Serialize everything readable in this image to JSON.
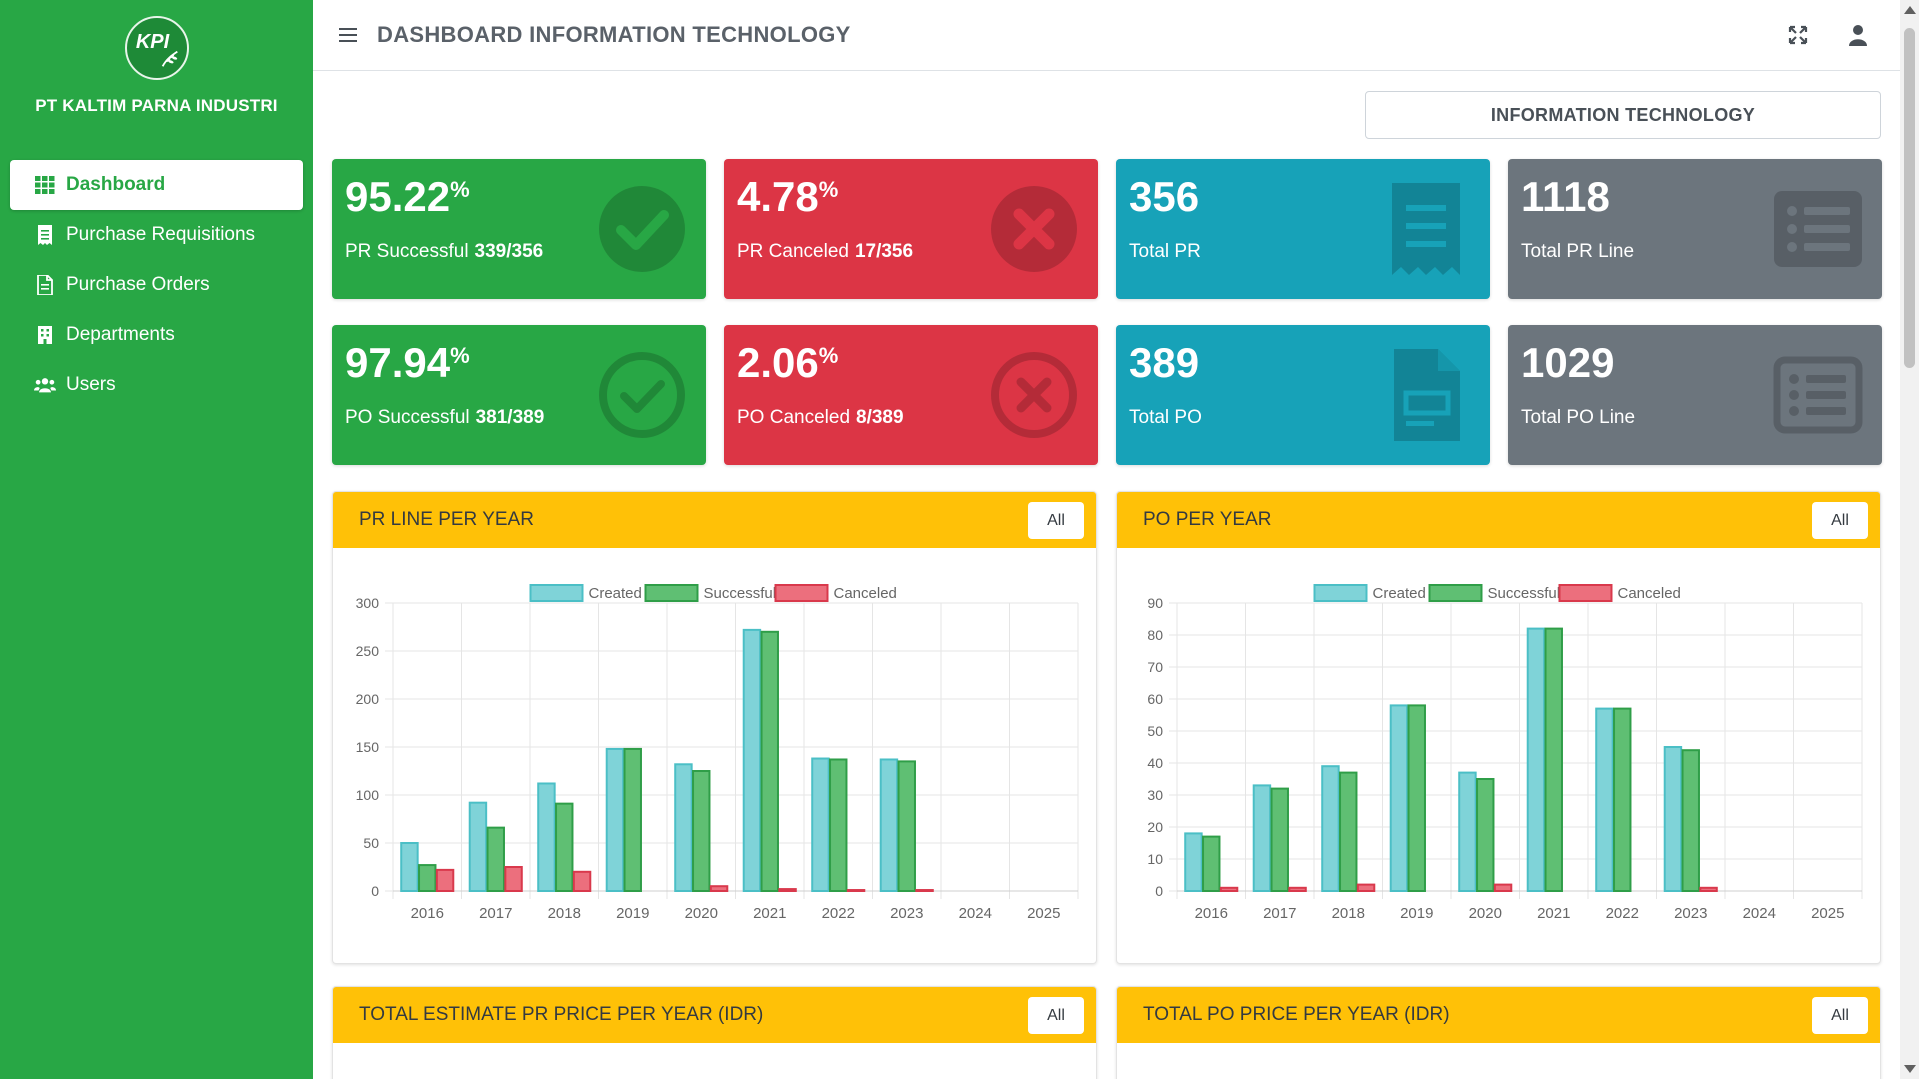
{
  "sidebar": {
    "logo_text": "KPI",
    "brand_name": "PT KALTIM PARNA INDUSTRI",
    "items": [
      {
        "label": "Dashboard",
        "icon": "grid-icon",
        "active": true
      },
      {
        "label": "Purchase Requisitions",
        "icon": "receipt-icon",
        "active": false
      },
      {
        "label": "Purchase Orders",
        "icon": "document-icon",
        "active": false
      },
      {
        "label": "Departments",
        "icon": "building-icon",
        "active": false
      },
      {
        "label": "Users",
        "icon": "users-icon",
        "active": false
      }
    ]
  },
  "header": {
    "title": "DASHBOARD INFORMATION TECHNOLOGY",
    "icons": [
      "menu-icon",
      "expand-icon",
      "user-icon"
    ]
  },
  "department_button": "INFORMATION TECHNOLOGY",
  "stats": {
    "pr_successful": {
      "value": "95.22",
      "unit": "%",
      "label": "PR Successful",
      "detail": "339/356"
    },
    "pr_canceled": {
      "value": "4.78",
      "unit": "%",
      "label": "PR Canceled",
      "detail": "17/356"
    },
    "total_pr": {
      "value": "356",
      "label": "Total PR"
    },
    "total_pr_line": {
      "value": "1118",
      "label": "Total PR Line"
    },
    "po_successful": {
      "value": "97.94",
      "unit": "%",
      "label": "PO Successful",
      "detail": "381/389"
    },
    "po_canceled": {
      "value": "2.06",
      "unit": "%",
      "label": "PO Canceled",
      "detail": "8/389"
    },
    "total_po": {
      "value": "389",
      "label": "Total PO"
    },
    "total_po_line": {
      "value": "1029",
      "label": "Total PO Line"
    }
  },
  "colors": {
    "green": "#28a745",
    "red": "#dc3545",
    "cyan": "#17a2b8",
    "gray": "#6c757d",
    "yellow": "#ffc107",
    "created_fill": "#7fd3d8",
    "created_stroke": "#4bbfc6",
    "successful_fill": "#5fbf73",
    "successful_stroke": "#2f9e48",
    "canceled_fill": "#ec6f7d",
    "canceled_stroke": "#d9394c"
  },
  "cards": {
    "pr_line": {
      "title": "PR LINE PER YEAR",
      "button": "All"
    },
    "po": {
      "title": "PO PER YEAR",
      "button": "All"
    },
    "pr_price": {
      "title": "TOTAL ESTIMATE PR PRICE PER YEAR (IDR)",
      "button": "All"
    },
    "po_price": {
      "title": "TOTAL PO PRICE PER YEAR (IDR)",
      "button": "All"
    }
  },
  "chart_data": [
    {
      "type": "bar",
      "title": "PR LINE PER YEAR",
      "categories": [
        "2016",
        "2017",
        "2018",
        "2019",
        "2020",
        "2021",
        "2022",
        "2023",
        "2024",
        "2025"
      ],
      "series": [
        {
          "name": "Created",
          "values": [
            50,
            92,
            112,
            148,
            132,
            272,
            138,
            137,
            0,
            0
          ]
        },
        {
          "name": "Successful",
          "values": [
            27,
            66,
            91,
            148,
            125,
            270,
            137,
            135,
            0,
            0
          ]
        },
        {
          "name": "Canceled",
          "values": [
            22,
            25,
            20,
            0,
            5,
            2,
            1,
            1,
            0,
            0
          ]
        }
      ],
      "ylim": [
        0,
        300
      ],
      "yticks": [
        0,
        50,
        100,
        150,
        200,
        250,
        300
      ],
      "legend": "top-center",
      "grid": true
    },
    {
      "type": "bar",
      "title": "PO PER YEAR",
      "categories": [
        "2016",
        "2017",
        "2018",
        "2019",
        "2020",
        "2021",
        "2022",
        "2023",
        "2024",
        "2025"
      ],
      "series": [
        {
          "name": "Created",
          "values": [
            18,
            33,
            39,
            58,
            37,
            82,
            57,
            45,
            0,
            0
          ]
        },
        {
          "name": "Successful",
          "values": [
            17,
            32,
            37,
            58,
            35,
            82,
            57,
            44,
            0,
            0
          ]
        },
        {
          "name": "Canceled",
          "values": [
            1,
            1,
            2,
            0,
            2,
            0,
            0,
            1,
            0,
            0
          ]
        }
      ],
      "ylim": [
        0,
        90
      ],
      "yticks": [
        0,
        10,
        20,
        30,
        40,
        50,
        60,
        70,
        80,
        90
      ],
      "legend": "top-center",
      "grid": true
    }
  ]
}
